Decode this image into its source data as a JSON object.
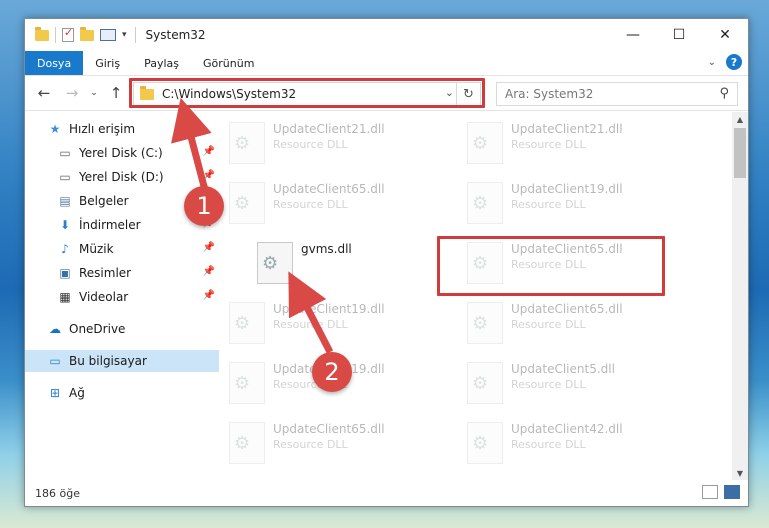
{
  "window": {
    "title": "System32"
  },
  "controls": {
    "minimize": "—",
    "maximize": "☐",
    "close": "✕"
  },
  "ribbon": {
    "tabs": [
      "Dosya",
      "Giriş",
      "Paylaş",
      "Görünüm"
    ],
    "help": "?"
  },
  "nav": {
    "address": "C:\\Windows\\System32",
    "search_placeholder": "Ara: System32"
  },
  "sidebar": {
    "items": [
      {
        "label": "Hızlı erişim",
        "icon": "star-icon"
      },
      {
        "label": "Yerel Disk (C:)",
        "icon": "drive-icon",
        "pinned": true
      },
      {
        "label": "Yerel Disk (D:)",
        "icon": "drive-icon",
        "pinned": true
      },
      {
        "label": "Belgeler",
        "icon": "documents-icon",
        "pinned": true
      },
      {
        "label": "İndirmeler",
        "icon": "download-icon",
        "pinned": true
      },
      {
        "label": "Müzik",
        "icon": "music-icon",
        "pinned": true
      },
      {
        "label": "Resimler",
        "icon": "pictures-icon",
        "pinned": true
      },
      {
        "label": "Videolar",
        "icon": "videos-icon",
        "pinned": true
      },
      {
        "label": "OneDrive",
        "icon": "cloud-icon"
      },
      {
        "label": "Bu bilgisayar",
        "icon": "computer-icon",
        "selected": true
      },
      {
        "label": "Ağ",
        "icon": "network-icon"
      }
    ]
  },
  "files": {
    "left": [
      {
        "name": "UpdateClient21.dll",
        "type": "Resource DLL"
      },
      {
        "name": "UpdateClient65.dll",
        "type": "Resource DLL"
      },
      {
        "name": "gvms.dll",
        "type": ""
      },
      {
        "name": "UpdateClient19.dll",
        "type": "Resource DLL"
      },
      {
        "name": "UpdateClient19.dll",
        "type": "Resource DLL"
      },
      {
        "name": "UpdateClient65.dll",
        "type": "Resource DLL"
      }
    ],
    "right": [
      {
        "name": "UpdateClient21.dll",
        "type": "Resource DLL"
      },
      {
        "name": "UpdateClient19.dll",
        "type": "Resource DLL"
      },
      {
        "name": "UpdateClient65.dll",
        "type": "Resource DLL"
      },
      {
        "name": "UpdateClient65.dll",
        "type": "Resource DLL"
      },
      {
        "name": "UpdateClient5.dll",
        "type": "Resource DLL"
      },
      {
        "name": "UpdateClient42.dll",
        "type": "Resource DLL"
      }
    ]
  },
  "status": {
    "count": "186 öğe"
  },
  "callouts": {
    "step1": "1",
    "step2": "2",
    "color": "#d94a47"
  }
}
